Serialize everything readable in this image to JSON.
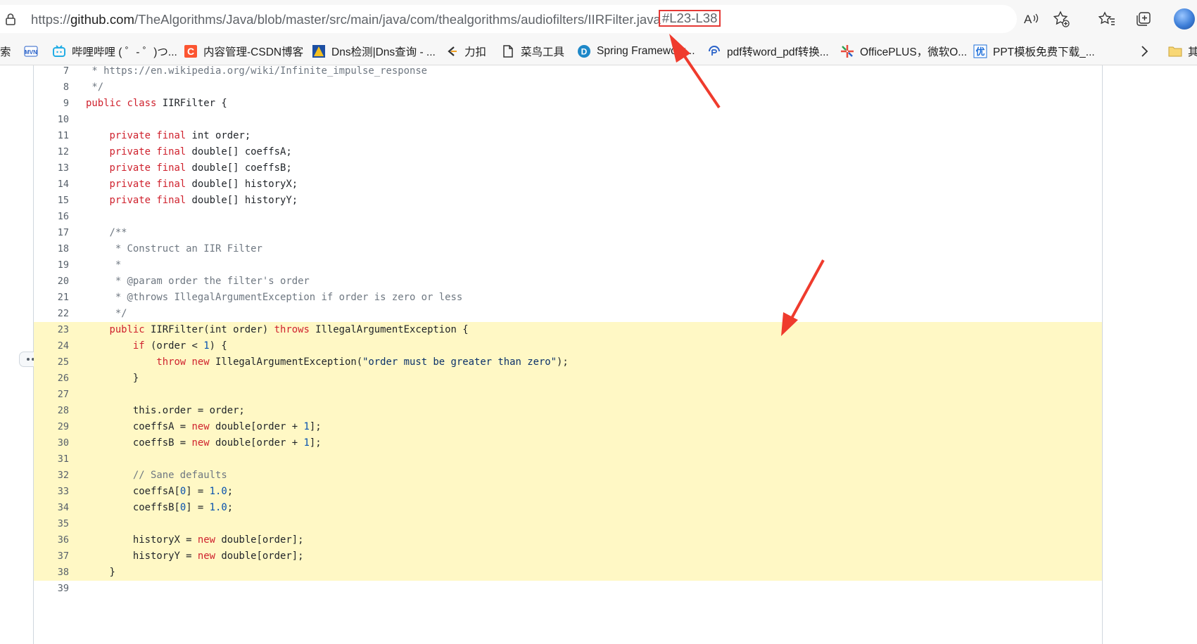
{
  "address_bar": {
    "url_host_prefix": "https://",
    "url_host": "github.com",
    "url_path": "/TheAlgorithms/Java/blob/master/src/main/java/com/thealgorithms/audiofilters/IIRFilter.java",
    "url_fragment": "#L23-L38"
  },
  "bookmarks": [
    {
      "label": "索",
      "icon": "search-partial-icon"
    },
    {
      "label": "",
      "icon": "mvn-icon"
    },
    {
      "label": "哔哩哔哩 ( ゜- ゜)つ...",
      "icon": "bilibili-icon"
    },
    {
      "label": "内容管理-CSDN博客",
      "icon": "csdn-icon"
    },
    {
      "label": "Dns检测|Dns查询 - ...",
      "icon": "dns-icon"
    },
    {
      "label": "力扣",
      "icon": "leetcode-icon"
    },
    {
      "label": "菜鸟工具",
      "icon": "document-icon"
    },
    {
      "label": "Spring Framework...",
      "icon": "spring-icon"
    },
    {
      "label": "pdf转word_pdf转换...",
      "icon": "pdf-icon"
    },
    {
      "label": "OfficePLUS，微软O...",
      "icon": "officeplus-icon"
    },
    {
      "label": "PPT模板免费下载_...",
      "icon": "ppt-icon"
    },
    {
      "label": "其",
      "icon": "folder-icon"
    }
  ],
  "code_lines": [
    {
      "n": "7",
      "tokens": [
        {
          "t": " * https://en.wikipedia.org/wiki/Infinite_impulse_response",
          "c": "com"
        }
      ]
    },
    {
      "n": "8",
      "tokens": [
        {
          "t": " */",
          "c": "com"
        }
      ]
    },
    {
      "n": "9",
      "tokens": [
        {
          "t": "public class ",
          "c": "kw"
        },
        {
          "t": "IIRFilter {",
          "c": "fn"
        }
      ]
    },
    {
      "n": "10",
      "tokens": []
    },
    {
      "n": "11",
      "tokens": [
        {
          "t": "    private final ",
          "c": "kw"
        },
        {
          "t": "int order;",
          "c": ""
        }
      ]
    },
    {
      "n": "12",
      "tokens": [
        {
          "t": "    private final ",
          "c": "kw"
        },
        {
          "t": "double[] coeffsA;",
          "c": ""
        }
      ]
    },
    {
      "n": "13",
      "tokens": [
        {
          "t": "    private final ",
          "c": "kw"
        },
        {
          "t": "double[] coeffsB;",
          "c": ""
        }
      ]
    },
    {
      "n": "14",
      "tokens": [
        {
          "t": "    private final ",
          "c": "kw"
        },
        {
          "t": "double[] historyX;",
          "c": ""
        }
      ]
    },
    {
      "n": "15",
      "tokens": [
        {
          "t": "    private final ",
          "c": "kw"
        },
        {
          "t": "double[] historyY;",
          "c": ""
        }
      ]
    },
    {
      "n": "16",
      "tokens": []
    },
    {
      "n": "17",
      "tokens": [
        {
          "t": "    /**",
          "c": "com"
        }
      ]
    },
    {
      "n": "18",
      "tokens": [
        {
          "t": "     * Construct an IIR Filter",
          "c": "com"
        }
      ]
    },
    {
      "n": "19",
      "tokens": [
        {
          "t": "     *",
          "c": "com"
        }
      ]
    },
    {
      "n": "20",
      "tokens": [
        {
          "t": "     * @param order the filter's order",
          "c": "com"
        }
      ]
    },
    {
      "n": "21",
      "tokens": [
        {
          "t": "     * @throws IllegalArgumentException if order is zero or less",
          "c": "com"
        }
      ]
    },
    {
      "n": "22",
      "tokens": [
        {
          "t": "     */",
          "c": "com"
        }
      ]
    },
    {
      "n": "23",
      "hl": true,
      "tokens": [
        {
          "t": "    public ",
          "c": "kw"
        },
        {
          "t": "IIRFilter(int order) ",
          "c": ""
        },
        {
          "t": "throws ",
          "c": "kw"
        },
        {
          "t": "IllegalArgumentException {",
          "c": ""
        }
      ]
    },
    {
      "n": "24",
      "hl": true,
      "tokens": [
        {
          "t": "        if ",
          "c": "kw"
        },
        {
          "t": "(order < ",
          "c": ""
        },
        {
          "t": "1",
          "c": "num"
        },
        {
          "t": ") {",
          "c": ""
        }
      ]
    },
    {
      "n": "25",
      "hl": true,
      "tokens": [
        {
          "t": "            throw new ",
          "c": "kw"
        },
        {
          "t": "IllegalArgumentException(",
          "c": ""
        },
        {
          "t": "\"order must be greater than zero\"",
          "c": "str"
        },
        {
          "t": ");",
          "c": ""
        }
      ]
    },
    {
      "n": "26",
      "hl": true,
      "tokens": [
        {
          "t": "        }",
          "c": ""
        }
      ]
    },
    {
      "n": "27",
      "hl": true,
      "tokens": []
    },
    {
      "n": "28",
      "hl": true,
      "tokens": [
        {
          "t": "        this.order = order;",
          "c": ""
        }
      ]
    },
    {
      "n": "29",
      "hl": true,
      "tokens": [
        {
          "t": "        coeffsA = ",
          "c": ""
        },
        {
          "t": "new ",
          "c": "kw"
        },
        {
          "t": "double[order + ",
          "c": ""
        },
        {
          "t": "1",
          "c": "num"
        },
        {
          "t": "];",
          "c": ""
        }
      ]
    },
    {
      "n": "30",
      "hl": true,
      "tokens": [
        {
          "t": "        coeffsB = ",
          "c": ""
        },
        {
          "t": "new ",
          "c": "kw"
        },
        {
          "t": "double[order + ",
          "c": ""
        },
        {
          "t": "1",
          "c": "num"
        },
        {
          "t": "];",
          "c": ""
        }
      ]
    },
    {
      "n": "31",
      "hl": true,
      "tokens": []
    },
    {
      "n": "32",
      "hl": true,
      "tokens": [
        {
          "t": "        // Sane defaults",
          "c": "com"
        }
      ]
    },
    {
      "n": "33",
      "hl": true,
      "tokens": [
        {
          "t": "        coeffsA[",
          "c": ""
        },
        {
          "t": "0",
          "c": "num"
        },
        {
          "t": "] = ",
          "c": ""
        },
        {
          "t": "1.0",
          "c": "num"
        },
        {
          "t": ";",
          "c": ""
        }
      ]
    },
    {
      "n": "34",
      "hl": true,
      "tokens": [
        {
          "t": "        coeffsB[",
          "c": ""
        },
        {
          "t": "0",
          "c": "num"
        },
        {
          "t": "] = ",
          "c": ""
        },
        {
          "t": "1.0",
          "c": "num"
        },
        {
          "t": ";",
          "c": ""
        }
      ]
    },
    {
      "n": "35",
      "hl": true,
      "tokens": []
    },
    {
      "n": "36",
      "hl": true,
      "tokens": [
        {
          "t": "        historyX = ",
          "c": ""
        },
        {
          "t": "new ",
          "c": "kw"
        },
        {
          "t": "double[order];",
          "c": ""
        }
      ]
    },
    {
      "n": "37",
      "hl": true,
      "tokens": [
        {
          "t": "        historyY = ",
          "c": ""
        },
        {
          "t": "new ",
          "c": "kw"
        },
        {
          "t": "double[order];",
          "c": ""
        }
      ]
    },
    {
      "n": "38",
      "hl": true,
      "tokens": [
        {
          "t": "    }",
          "c": ""
        }
      ]
    },
    {
      "n": "39",
      "tokens": []
    }
  ],
  "colors": {
    "highlight": "#fff8c5",
    "keyword": "#cf222e",
    "number": "#0550ae",
    "string": "#0a3069",
    "comment": "#6e7781",
    "annotation_red": "#e53935"
  }
}
